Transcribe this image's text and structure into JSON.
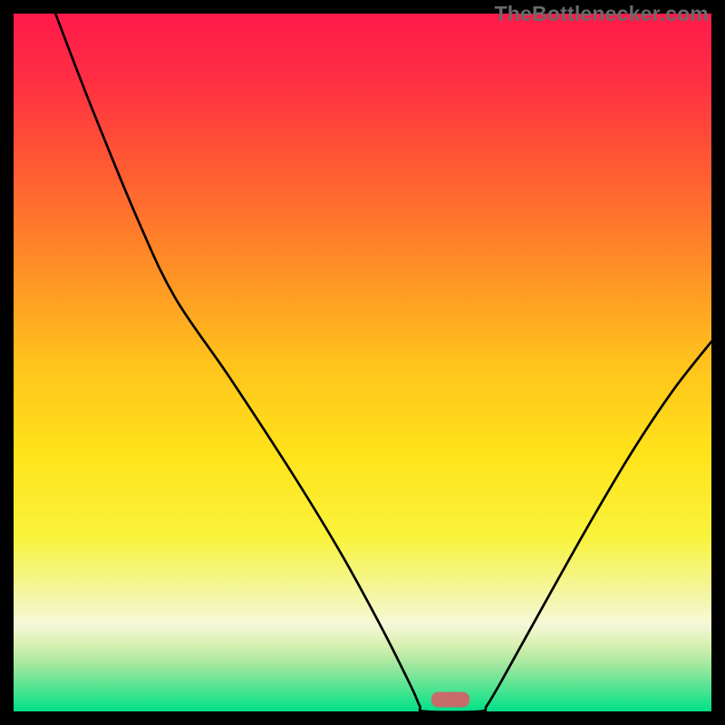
{
  "watermark": "TheBottlenecker.com",
  "chart_data": {
    "type": "line",
    "title": "",
    "xlabel": "",
    "ylabel": "",
    "xlim": [
      0,
      1000
    ],
    "ylim": [
      0,
      1000
    ],
    "gradient_stops": [
      {
        "offset": 0.0,
        "color": "#ff1a4b"
      },
      {
        "offset": 0.09,
        "color": "#ff2d43"
      },
      {
        "offset": 0.22,
        "color": "#ff5a33"
      },
      {
        "offset": 0.35,
        "color": "#ff8a26"
      },
      {
        "offset": 0.5,
        "color": "#ffc21c"
      },
      {
        "offset": 0.63,
        "color": "#ffe31a"
      },
      {
        "offset": 0.75,
        "color": "#f9f33c"
      },
      {
        "offset": 0.83,
        "color": "#f3f6a0"
      },
      {
        "offset": 0.875,
        "color": "#f6f8d8"
      },
      {
        "offset": 0.905,
        "color": "#d8f0b0"
      },
      {
        "offset": 0.93,
        "color": "#a8e8a0"
      },
      {
        "offset": 0.955,
        "color": "#6de596"
      },
      {
        "offset": 0.985,
        "color": "#23e38c"
      },
      {
        "offset": 1.0,
        "color": "#00df88"
      }
    ],
    "series": [
      {
        "name": "bottleneck-curve",
        "points": [
          {
            "x": 60,
            "y": 1000
          },
          {
            "x": 110,
            "y": 870
          },
          {
            "x": 180,
            "y": 700
          },
          {
            "x": 232,
            "y": 592
          },
          {
            "x": 310,
            "y": 478
          },
          {
            "x": 400,
            "y": 340
          },
          {
            "x": 470,
            "y": 225
          },
          {
            "x": 530,
            "y": 115
          },
          {
            "x": 570,
            "y": 35
          },
          {
            "x": 582,
            "y": 8
          },
          {
            "x": 590,
            "y": 0
          },
          {
            "x": 668,
            "y": 0
          },
          {
            "x": 678,
            "y": 8
          },
          {
            "x": 700,
            "y": 45
          },
          {
            "x": 750,
            "y": 135
          },
          {
            "x": 820,
            "y": 260
          },
          {
            "x": 885,
            "y": 370
          },
          {
            "x": 945,
            "y": 460
          },
          {
            "x": 1000,
            "y": 530
          }
        ]
      }
    ],
    "marker": {
      "x_center": 626,
      "y": 6,
      "width": 55,
      "height": 22,
      "rx": 10,
      "color": "#c76b6b"
    }
  }
}
